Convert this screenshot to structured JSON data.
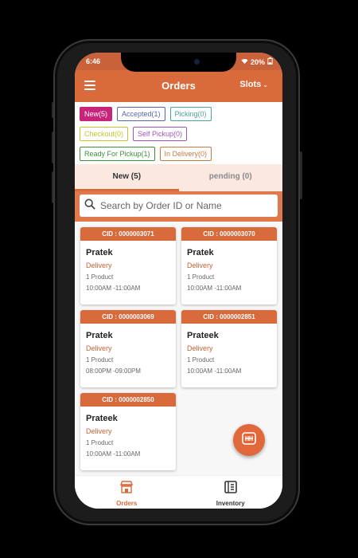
{
  "status": {
    "time": "6:46",
    "battery": "20%"
  },
  "appbar": {
    "title": "Orders",
    "slots_label": "Slots"
  },
  "chips": [
    {
      "label": "New(5)",
      "color": "#c8247a",
      "active": true
    },
    {
      "label": "Accepted(1)",
      "color": "#5566aa",
      "active": false
    },
    {
      "label": "Picking(0)",
      "color": "#4aa39a",
      "active": false
    },
    {
      "label": "Checkout(0)",
      "color": "#c6c62a",
      "active": false
    },
    {
      "label": "Self Pickup(0)",
      "color": "#a056b8",
      "active": false
    },
    {
      "label": "Ready For Pickup(1)",
      "color": "#3f8f3f",
      "active": false
    },
    {
      "label": "In Delivery(0)",
      "color": "#c97a44",
      "active": false
    }
  ],
  "tabs": {
    "new": "New (5)",
    "pending": "pending (0)"
  },
  "search": {
    "placeholder": "Search by Order ID or Name"
  },
  "orders": [
    {
      "cid": "CID : 0000003071",
      "name": "Pratek",
      "type": "Delivery",
      "products": "1 Product",
      "slot": "10:00AM -11:00AM"
    },
    {
      "cid": "CID : 0000003070",
      "name": "Pratek",
      "type": "Delivery",
      "products": "1 Product",
      "slot": "10:00AM -11:00AM"
    },
    {
      "cid": "CID : 0000003069",
      "name": "Pratek",
      "type": "Delivery",
      "products": "1 Product",
      "slot": "08:00PM -09:00PM"
    },
    {
      "cid": "CID : 0000002851",
      "name": "Prateek",
      "type": "Delivery",
      "products": "1 Product",
      "slot": "10:00AM -11:00AM"
    },
    {
      "cid": "CID : 0000002850",
      "name": "Prateek",
      "type": "Delivery",
      "products": "1 Product",
      "slot": "10:00AM -11:00AM"
    }
  ],
  "nav": {
    "orders": "Orders",
    "inventory": "Inventory"
  },
  "colors": {
    "accent": "#d96a3c",
    "accent_dark": "#c9623a"
  }
}
